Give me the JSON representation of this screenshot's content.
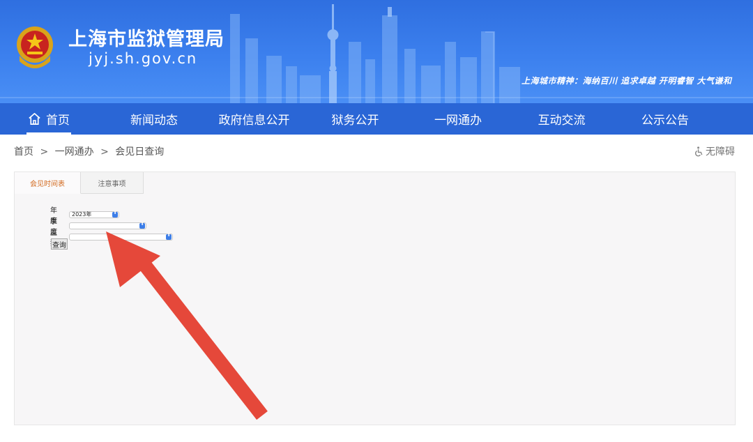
{
  "header": {
    "title": "上海市监狱管理局",
    "domain": "jyj.sh.gov.cn",
    "slogan": "上海城市精神：海纳百川 追求卓越 开明睿智 大气谦和",
    "banner_color": "#3c80ee"
  },
  "nav": {
    "items": [
      {
        "label": "首页",
        "icon": "home-icon"
      },
      {
        "label": "新闻动态"
      },
      {
        "label": "政府信息公开"
      },
      {
        "label": "狱务公开"
      },
      {
        "label": "一网通办"
      },
      {
        "label": "互动交流"
      },
      {
        "label": "公示公告"
      }
    ],
    "active": "首页",
    "color": "#2a66d6"
  },
  "breadcrumb": {
    "items": [
      "首页",
      "一网通办",
      "会见日查询"
    ],
    "separator": ">"
  },
  "accessibility": {
    "label": "无障碍",
    "icon": "wheelchair-icon"
  },
  "tabs": [
    {
      "label": "会见时间表",
      "active": true
    },
    {
      "label": "注意事项",
      "active": false
    }
  ],
  "form": {
    "year": {
      "label": "年 度",
      "value": "2023年"
    },
    "quarter": {
      "label": "季 度",
      "value": ""
    },
    "prison": {
      "label": "监 狱",
      "value": ""
    },
    "query_label": "查询"
  },
  "annotation": {
    "type": "arrow",
    "color": "#e5483a"
  }
}
